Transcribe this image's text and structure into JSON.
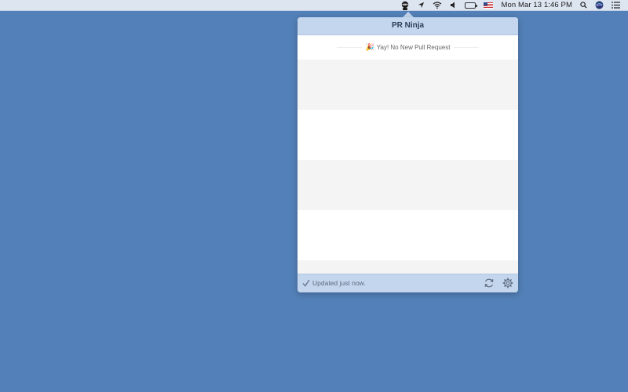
{
  "menubar": {
    "icons": [
      "ninja-icon",
      "location-arrow-icon",
      "wifi-icon",
      "volume-icon",
      "battery-icon",
      "us-flag-icon"
    ],
    "clock": "Mon Mar 13  1:46 PM",
    "right_icons": [
      "spotlight-search-icon",
      "siri-icon",
      "notification-center-icon"
    ]
  },
  "popover": {
    "title": "PR Ninja",
    "status_message": "Yay! No New Pull Request",
    "status_icon": "party-popper-icon",
    "footer": {
      "updated_text": "Updated just now.",
      "check_icon": "checkmark-icon",
      "refresh_icon": "refresh-icon",
      "settings_icon": "gear-icon"
    }
  },
  "colors": {
    "desktop": "#5380b8",
    "menubar": "#dde5f1",
    "popover_chrome": "#c3d6ee",
    "stripe_gray": "#f4f4f4"
  }
}
